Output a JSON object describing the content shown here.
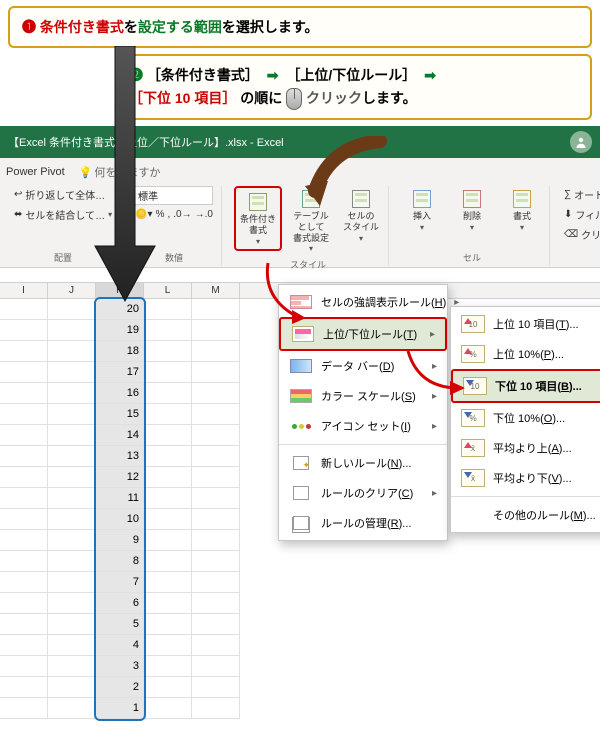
{
  "instruction1": {
    "num": "❶",
    "red": "条件付き書式",
    "mid": "を",
    "green": "設定する範囲",
    "tail": "を選択します。"
  },
  "instruction2": {
    "num": "❷",
    "part1": "［条件付き書式］",
    "arrow": "➡",
    "part2": "［上位/下位ルール］",
    "part3": "［下位 10 項目］",
    "part4": "の順に",
    "part5": "クリック",
    "part6": "します。"
  },
  "titlebar": {
    "filename": "【Excel 条件付き書式｜上位／下位ルール】.xlsx  -  Excel"
  },
  "ribbon": {
    "tab_power_pivot": "Power Pivot",
    "tell_me": "何をしますか",
    "wrap_text": "折り返して全体…",
    "merge_center": "セルを結合して…",
    "alignment_group": "配置",
    "number_format": "標準",
    "number_group": "数値",
    "conditional_formatting": "条件付き\n書式",
    "format_as_table": "テーブルとして\n書式設定",
    "cell_styles": "セルの\nスタイル",
    "styles_group": "スタイル",
    "insert": "挿入",
    "delete": "削除",
    "format": "書式",
    "cells_group": "セル",
    "autosum": "オート SU",
    "fill": "フィル",
    "clear": "クリア"
  },
  "menu1": {
    "highlight_cells": "セルの強調表示ルール(",
    "highlight_cells_u": "H",
    "highlight_cells_end": ")",
    "top_bottom": "上位/下位ルール(",
    "top_bottom_u": "T",
    "top_bottom_end": ")",
    "data_bars": "データ バー(",
    "data_bars_u": "D",
    "data_bars_end": ")",
    "color_scales": "カラー スケール(",
    "color_scales_u": "S",
    "color_scales_end": ")",
    "icon_sets": "アイコン セット(",
    "icon_sets_u": "I",
    "icon_sets_end": ")",
    "new_rule": "新しいルール(",
    "new_rule_u": "N",
    "new_rule_end": ")...",
    "clear_rules": "ルールのクリア(",
    "clear_rules_u": "C",
    "clear_rules_end": ")",
    "manage_rules": "ルールの管理(",
    "manage_rules_u": "R",
    "manage_rules_end": ")..."
  },
  "menu2": {
    "top10_items": "上位 10 項目(",
    "top10_items_u": "T",
    "top10_items_end": ")...",
    "top10_percent": "上位 10%(",
    "top10_percent_u": "P",
    "top10_percent_end": ")...",
    "bottom10_items": "下位 10 項目(",
    "bottom10_items_u": "B",
    "bottom10_items_end": ")...",
    "bottom10_percent": "下位 10%(",
    "bottom10_percent_u": "O",
    "bottom10_percent_end": ")...",
    "above_avg": "平均より上(",
    "above_avg_u": "A",
    "above_avg_end": ")...",
    "below_avg": "平均より下(",
    "below_avg_u": "V",
    "below_avg_end": ")...",
    "more_rules": "その他のルール(",
    "more_rules_u": "M",
    "more_rules_end": ")..."
  },
  "columns": [
    "I",
    "J",
    "K",
    "L",
    "M"
  ],
  "k_values": [
    20,
    19,
    18,
    17,
    16,
    15,
    14,
    13,
    12,
    11,
    10,
    9,
    8,
    7,
    6,
    5,
    4,
    3,
    2,
    1
  ]
}
